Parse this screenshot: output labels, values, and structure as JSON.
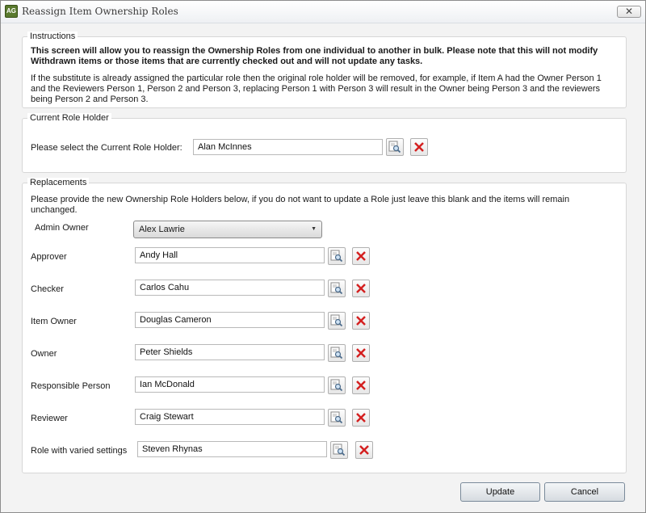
{
  "window": {
    "title": "Reassign Item Ownership Roles",
    "app_icon_text": "AG",
    "close_glyph": "✕"
  },
  "instructions": {
    "title": "Instructions",
    "bold_line1": "This screen will allow you to reassign the Ownership Roles from one individual to another in bulk. Please note that this will not modify",
    "bold_line2": "Withdrawn items or those items that are currently checked out and will not update any tasks.",
    "note_line1": "If the substitute is already assigned the particular role then the original role holder will be removed, for example, if Item A had the Owner Person 1",
    "note_line2": "and the Reviewers Person 1, Person 2 and Person 3, replacing Person 1 with Person 3 will result in the Owner being Person 3 and the reviewers",
    "note_line3": "being Person 2 and Person 3."
  },
  "current_holder": {
    "title": "Current Role Holder",
    "label": "Please select the Current Role Holder:",
    "value": "Alan McInnes"
  },
  "replacements": {
    "title": "Replacements",
    "desc_line1": "Please provide the new Ownership Role Holders below, if you do not want to update a Role just leave this blank and the items will remain",
    "desc_line2": "unchanged.",
    "admin_owner": {
      "label": "Admin Owner",
      "value": "Alex Lawrie"
    },
    "roles": [
      {
        "label": "Approver",
        "value": "Andy Hall"
      },
      {
        "label": "Checker",
        "value": "Carlos Cahu"
      },
      {
        "label": "Item Owner",
        "value": "Douglas Cameron"
      },
      {
        "label": "Owner",
        "value": "Peter Shields"
      },
      {
        "label": "Responsible Person",
        "value": "Ian McDonald"
      },
      {
        "label": "Reviewer",
        "value": "Craig Stewart"
      },
      {
        "label": "Role with varied settings",
        "value": "Steven Rhynas"
      }
    ]
  },
  "buttons": {
    "update": "Update",
    "cancel": "Cancel"
  },
  "colors": {
    "clear_x": "#d42020",
    "group_border": "#d7d7d7",
    "background": "#f3f3f3"
  }
}
